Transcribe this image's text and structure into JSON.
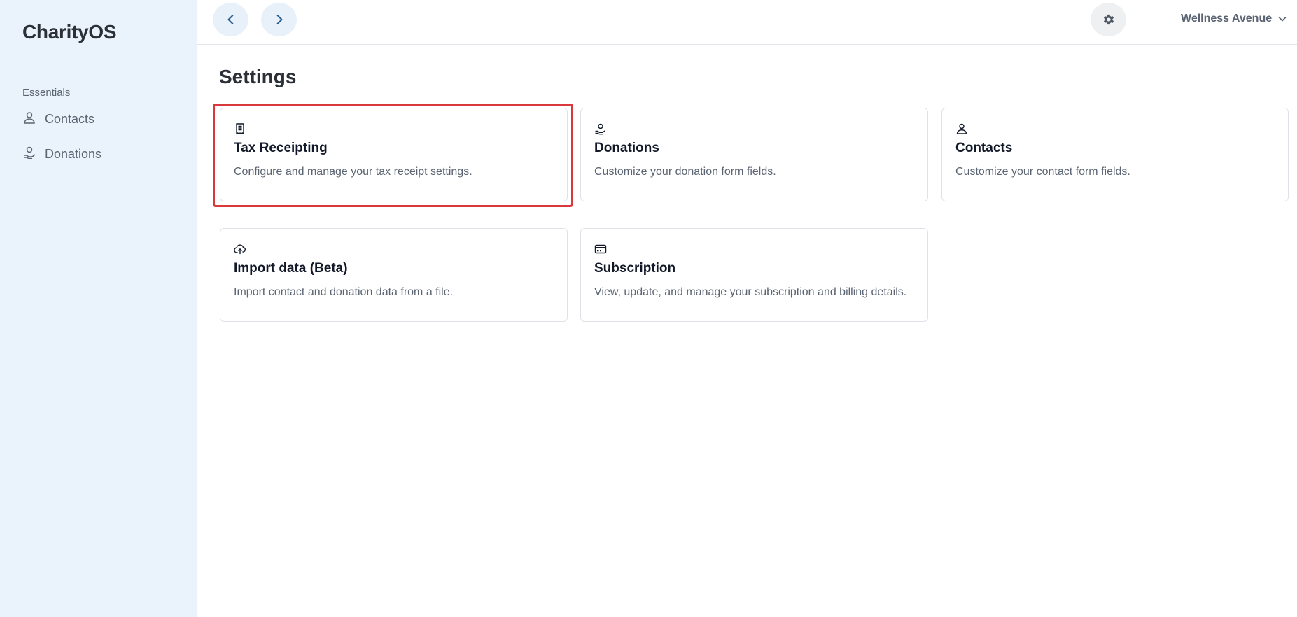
{
  "app": {
    "brand": "CharityOS"
  },
  "sidebar": {
    "section_label": "Essentials",
    "items": [
      {
        "label": "Contacts",
        "icon": "person-icon"
      },
      {
        "label": "Donations",
        "icon": "hand-coin-icon"
      }
    ]
  },
  "topbar": {
    "back_icon": "chevron-left-icon",
    "forward_icon": "chevron-right-icon",
    "settings_icon": "gear-icon",
    "org_name": "Wellness Avenue",
    "org_dropdown_icon": "chevron-down-icon"
  },
  "main": {
    "title": "Settings",
    "cards": [
      {
        "title": "Tax Receipting",
        "description": "Configure and manage your tax receipt settings.",
        "icon": "receipt-icon",
        "highlighted": true
      },
      {
        "title": "Donations",
        "description": "Customize your donation form fields.",
        "icon": "hand-coin-icon"
      },
      {
        "title": "Contacts",
        "description": "Customize your contact form fields.",
        "icon": "person-icon"
      },
      {
        "title": "Import data (Beta)",
        "description": "Import contact and donation data from a file.",
        "icon": "cloud-upload-icon"
      },
      {
        "title": "Subscription",
        "description": "View, update, and manage your subscription and billing details.",
        "icon": "credit-card-icon"
      }
    ]
  },
  "colors": {
    "sidebar_bg": "#eaf3fb",
    "highlight": "#d9393c",
    "nav_button_bg": "#e8f1f9",
    "accent_icon": "#2b5f8f"
  }
}
